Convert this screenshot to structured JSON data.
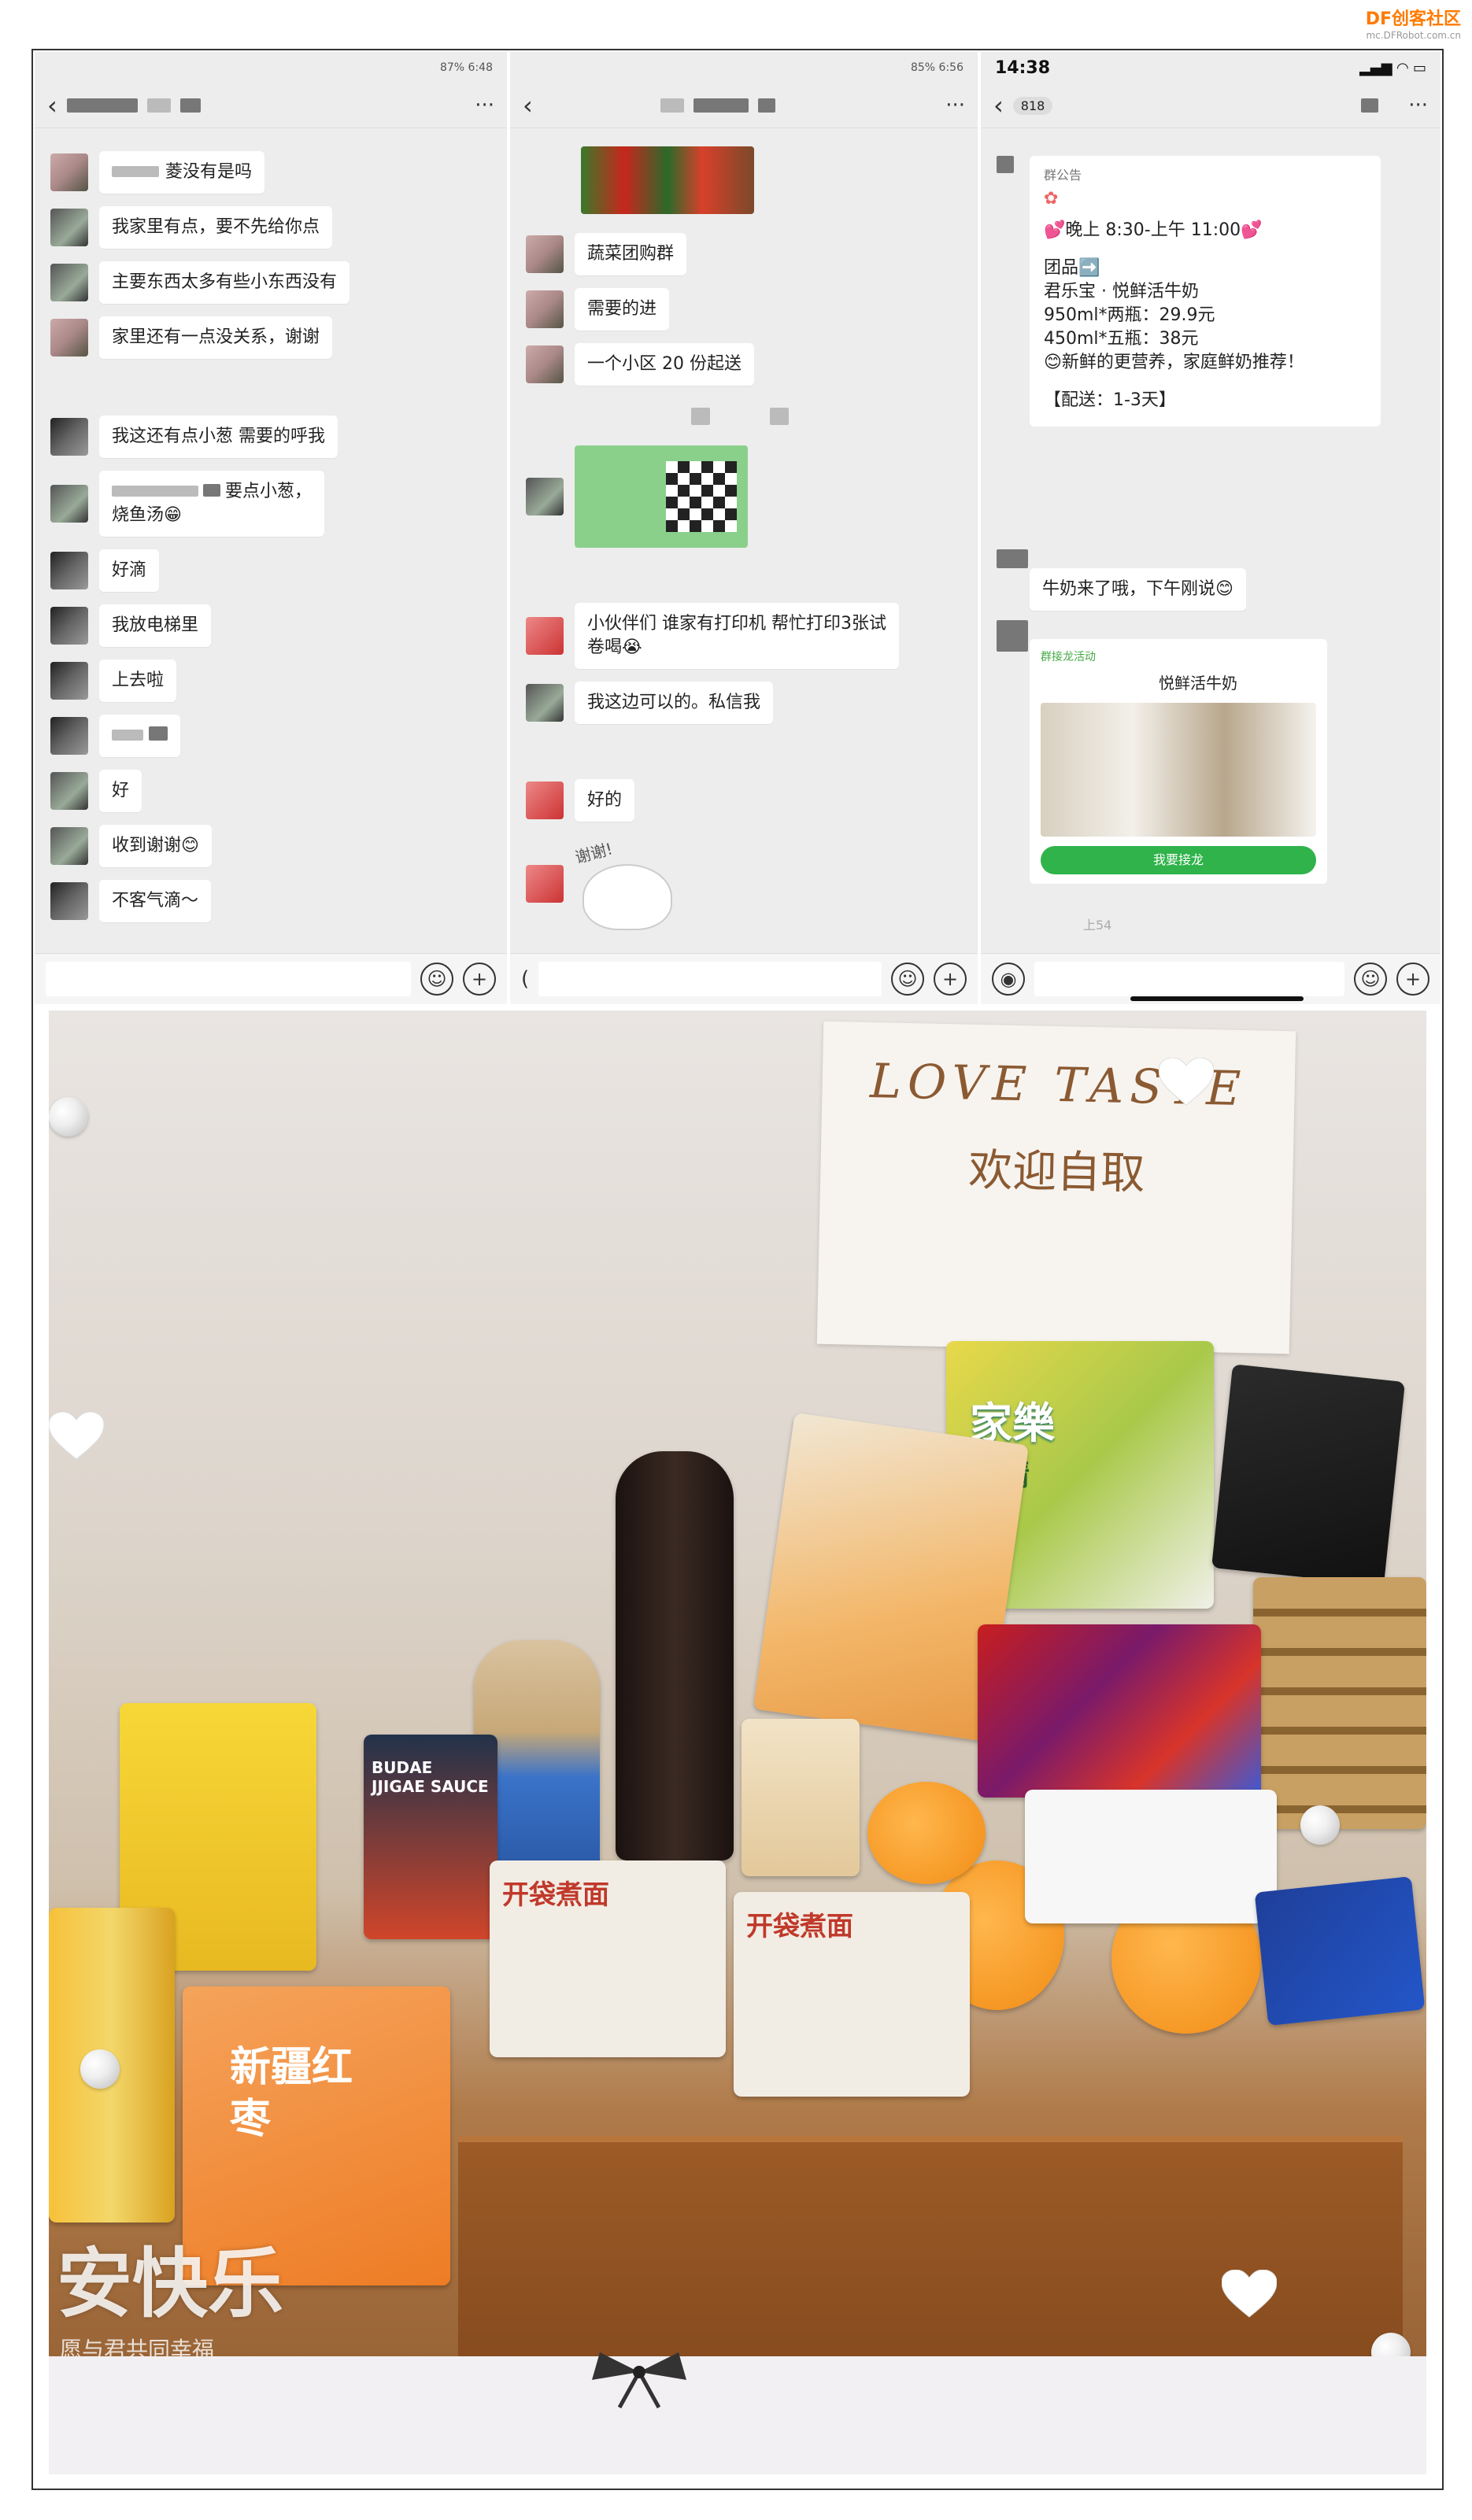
{
  "watermark": {
    "main": "DF创客社区",
    "sub": "mc.DFRobot.com.cn"
  },
  "panel1": {
    "status": "87% 6:48",
    "messages": [
      "菱没有是吗",
      "我家里有点，要不先给你点",
      "主要东西太多有些小东西没有",
      "家里还有一点没关系，谢谢",
      "我这还有点小葱 需要的呼我",
      "要点小葱，",
      "烧鱼汤😁",
      "好滴",
      "我放电梯里",
      "上去啦",
      "好",
      "收到谢谢😊",
      "不客气滴～"
    ]
  },
  "panel2": {
    "status": "85% 6:56",
    "messages": [
      "蔬菜团购群",
      "需要的进",
      "一个小区 20 份起送",
      "小伙伴们 谁家有打印机 帮忙打印3张试卷喝😭",
      "我这边可以的。私信我",
      "好的"
    ],
    "sticker_text": "谢谢!"
  },
  "panel3": {
    "time": "14:38",
    "badge": "818",
    "group_label": "群公告",
    "card": [
      "💕晚上 8:30-上午 11:00💕",
      "团品➡️",
      "君乐宝 · 悦鲜活牛奶",
      "950ml*两瓶：29.9元",
      "450ml*五瓶：38元",
      "😊新鲜的更营养，家庭鲜奶推荐！",
      "【配送：1-3天】"
    ],
    "reply": "牛奶来了哦，下午刚说😊",
    "product_header": "群接龙活动",
    "product_name": "悦鲜活牛奶",
    "product_button": "我要接龙",
    "time_tag": "上54"
  },
  "photo": {
    "sign_line1": "LOVE TASTE",
    "sign_line2": "欢迎自取",
    "bag_text": "新疆红枣",
    "overlay_text": "安快乐",
    "overlay_sub": "愿与君共同幸福",
    "jar_label": "家樂",
    "jar_sub": "鸡精",
    "sauce_label": "BUDAE JJIGAE SAUCE",
    "noodle1": "开袋煮面",
    "noodle2": "开袋煮面"
  }
}
